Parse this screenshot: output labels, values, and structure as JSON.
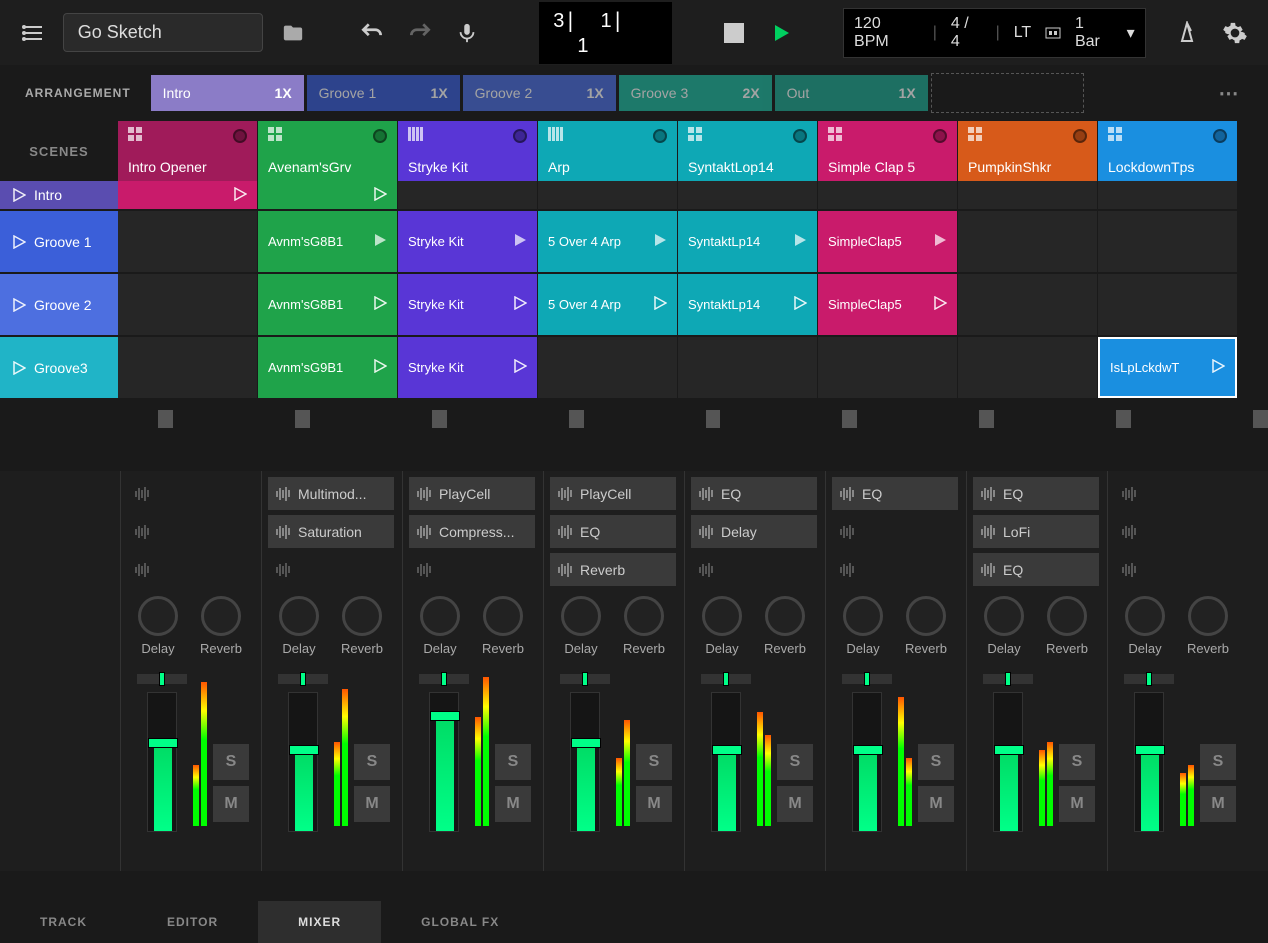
{
  "project_name": "Go Sketch",
  "counter": {
    "bars": "3",
    "beats": "1",
    "sub": "1"
  },
  "transport": {
    "bpm": "120 BPM",
    "sig": "4 / 4",
    "lt": "LT",
    "link": "1 Bar"
  },
  "arrangement_label": "ARRANGEMENT",
  "arrangement": [
    {
      "name": "Intro",
      "repeat": "1X",
      "color": "#8b7cc7"
    },
    {
      "name": "Groove 1",
      "repeat": "1X",
      "color": "#3b5fd9"
    },
    {
      "name": "Groove 2",
      "repeat": "1X",
      "color": "#4d6fe0"
    },
    {
      "name": "Groove 3",
      "repeat": "2X",
      "color": "#1fb89f"
    },
    {
      "name": "Out",
      "repeat": "1X",
      "color": "#1fa892"
    }
  ],
  "scenes_label": "SCENES",
  "scenes": [
    {
      "name": "Intro",
      "color": "#5a4db0"
    },
    {
      "name": "Groove 1",
      "color": "#3b5fd9"
    },
    {
      "name": "Groove 2",
      "color": "#4d6fe0"
    },
    {
      "name": "Groove3",
      "color": "#20b4c7"
    }
  ],
  "tracks": [
    {
      "name": "Intro Opener",
      "color": "#a01b5a",
      "icon": "drum"
    },
    {
      "name": "Avenam'sGrv",
      "color": "#1fa34a",
      "icon": "drum"
    },
    {
      "name": "Stryke Kit",
      "color": "#5936d6",
      "icon": "keys"
    },
    {
      "name": "Arp",
      "color": "#0ea8b5",
      "icon": "keys"
    },
    {
      "name": "SyntaktLop14",
      "color": "#0ea8b5",
      "icon": "drum"
    },
    {
      "name": "Simple Clap 5",
      "color": "#c91b6b",
      "icon": "drum"
    },
    {
      "name": "PumpkinShkr",
      "color": "#d75a1a",
      "icon": "drum"
    },
    {
      "name": "LockdownTps",
      "color": "#1a8fe0",
      "icon": "drum"
    }
  ],
  "clips": {
    "0": {
      "0": {
        "name": "",
        "color": "#c91b6b"
      },
      "1": {
        "name": "",
        "color": "#1fa34a"
      }
    },
    "1": {
      "1": {
        "name": "Avnm'sG8B1",
        "color": "#1fa34a",
        "p": "f"
      },
      "2": {
        "name": "Stryke Kit",
        "color": "#5936d6",
        "p": "f"
      },
      "3": {
        "name": "5 Over 4 Arp",
        "color": "#0ea8b5",
        "p": "f"
      },
      "4": {
        "name": "SyntaktLp14",
        "color": "#0ea8b5",
        "p": "f"
      },
      "5": {
        "name": "SimpleClap5",
        "color": "#c91b6b",
        "p": "f"
      }
    },
    "2": {
      "1": {
        "name": "Avnm'sG8B1",
        "color": "#1fa34a",
        "p": "o"
      },
      "2": {
        "name": "Stryke Kit",
        "color": "#5936d6",
        "p": "o"
      },
      "3": {
        "name": "5 Over 4 Arp",
        "color": "#0ea8b5",
        "p": "o"
      },
      "4": {
        "name": "SyntaktLp14",
        "color": "#0ea8b5",
        "p": "o"
      },
      "5": {
        "name": "SimpleClap5",
        "color": "#c91b6b",
        "p": "o"
      }
    },
    "3": {
      "1": {
        "name": "Avnm'sG9B1",
        "color": "#1fa34a",
        "p": "o"
      },
      "2": {
        "name": "Stryke Kit",
        "color": "#5936d6",
        "p": "o"
      },
      "7": {
        "name": "IsLpLckdwT",
        "color": "#1a8fe0",
        "p": "o",
        "hl": true
      }
    }
  },
  "mixer": [
    {
      "fx": [
        "",
        "",
        ""
      ],
      "fill": 60,
      "m": [
        40,
        95
      ]
    },
    {
      "fx": [
        "Multimod...",
        "Saturation",
        ""
      ],
      "fill": 55,
      "m": [
        55,
        90
      ]
    },
    {
      "fx": [
        "PlayCell",
        "Compress...",
        ""
      ],
      "fill": 80,
      "m": [
        72,
        98
      ]
    },
    {
      "fx": [
        "PlayCell",
        "EQ",
        "Reverb"
      ],
      "fill": 60,
      "m": [
        45,
        70
      ]
    },
    {
      "fx": [
        "EQ",
        "Delay",
        ""
      ],
      "fill": 55,
      "m": [
        75,
        60
      ]
    },
    {
      "fx": [
        "EQ",
        "",
        ""
      ],
      "fill": 55,
      "m": [
        85,
        45
      ]
    },
    {
      "fx": [
        "EQ",
        "LoFi",
        "EQ"
      ],
      "fill": 55,
      "m": [
        50,
        55
      ]
    },
    {
      "fx": [
        "",
        "",
        ""
      ],
      "fill": 55,
      "m": [
        35,
        40
      ]
    }
  ],
  "send_labels": {
    "delay": "Delay",
    "reverb": "Reverb"
  },
  "sm": {
    "s": "S",
    "m": "M"
  },
  "bottom_tabs": [
    "TRACK",
    "EDITOR",
    "MIXER",
    "GLOBAL FX"
  ],
  "active_tab": "MIXER"
}
